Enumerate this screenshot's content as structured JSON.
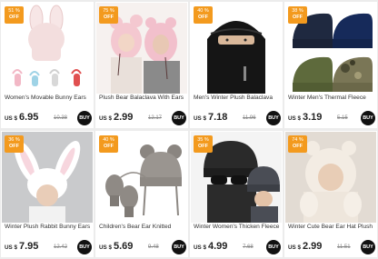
{
  "products": [
    {
      "discount": "51 %",
      "off": "OFF",
      "title": "Women's Movable Bunny Ears",
      "currency": "US $",
      "price": "6.95",
      "old_price": "10.38",
      "buy": "BUY"
    },
    {
      "discount": "75 %",
      "off": "OFF",
      "title": "Plush Bear Balaclava With Ears",
      "currency": "US $",
      "price": "2.99",
      "old_price": "12.17",
      "buy": "BUY"
    },
    {
      "discount": "40 %",
      "off": "OFF",
      "title": "Men's Winter Plush Balaclava",
      "currency": "US $",
      "price": "7.18",
      "old_price": "11.96",
      "buy": "BUY"
    },
    {
      "discount": "38 %",
      "off": "OFF",
      "title": "Winter Men's Thermal Fleece",
      "currency": "US $",
      "price": "3.19",
      "old_price": "5.15",
      "buy": "BUY"
    },
    {
      "discount": "36 %",
      "off": "OFF",
      "title": "Winter Plush Rabbit Bunny Ears",
      "currency": "US $",
      "price": "7.95",
      "old_price": "12.42",
      "buy": "BUY"
    },
    {
      "discount": "40 %",
      "off": "OFF",
      "title": "Children's Bear Ear Knitted",
      "currency": "US $",
      "price": "5.69",
      "old_price": "9.48",
      "buy": "BUY"
    },
    {
      "discount": "35 %",
      "off": "OFF",
      "title": "Winter Women's Thicken Fleece",
      "currency": "US $",
      "price": "4.99",
      "old_price": "7.68",
      "buy": "BUY"
    },
    {
      "discount": "74 %",
      "off": "OFF",
      "title": "Winter Cute Bear Ear Hat Plush",
      "currency": "US $",
      "price": "2.99",
      "old_price": "11.51",
      "buy": "BUY"
    }
  ],
  "colors": {
    "badge": "#f39a1e",
    "buy_button": "#111111",
    "card": "#ffffff",
    "background": "#ececec"
  }
}
